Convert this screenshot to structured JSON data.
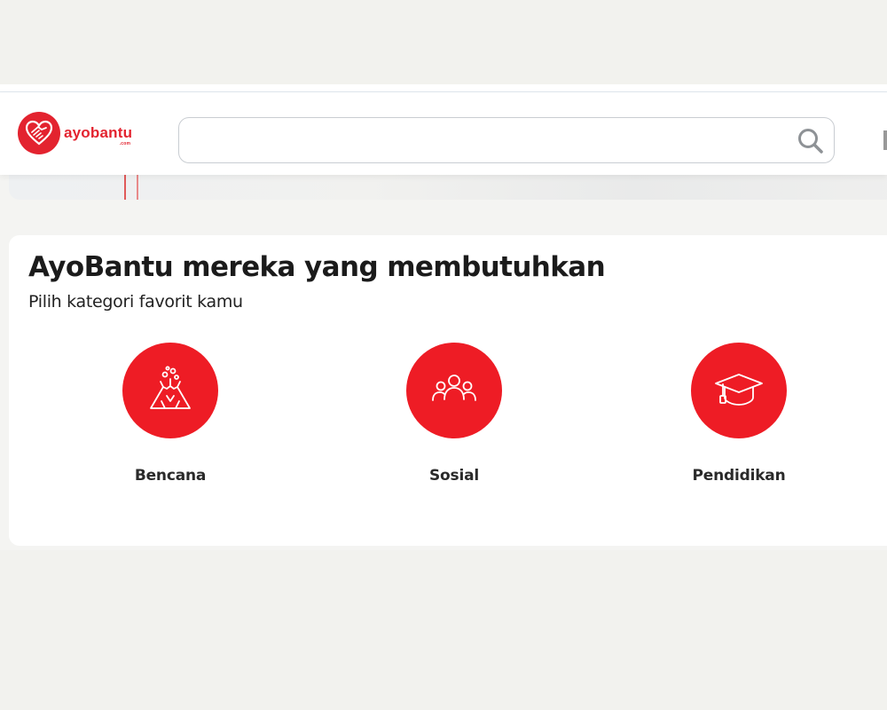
{
  "header": {
    "logo_text": "ayobantu",
    "logo_sub": ".com",
    "search": {
      "value": "",
      "placeholder": ""
    }
  },
  "section": {
    "title": "AyoBantu mereka yang membutuhkan",
    "subtitle": "Pilih kategori favorit kamu"
  },
  "categories": [
    {
      "label": "Bencana",
      "icon": "volcano-icon"
    },
    {
      "label": "Sosial",
      "icon": "people-group-icon"
    },
    {
      "label": "Pendidikan",
      "icon": "graduation-cap-icon"
    }
  ],
  "colors": {
    "brand_red": "#ee1c25",
    "page_bg": "#f2f2ee",
    "text_dark": "#1b1b1b"
  }
}
